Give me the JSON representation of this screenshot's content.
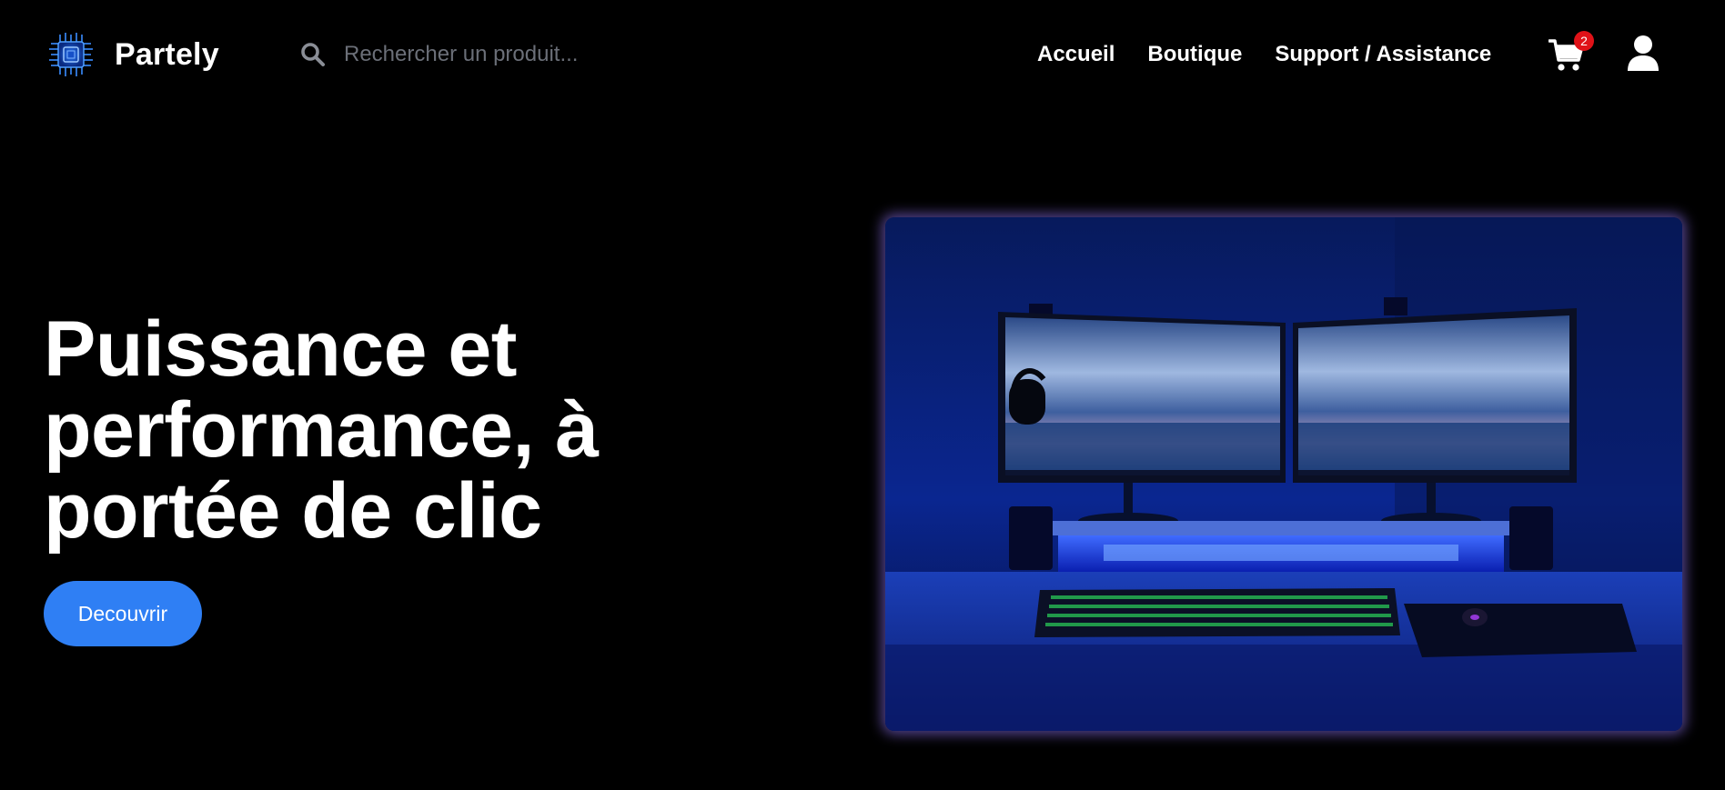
{
  "brand": {
    "name": "Partely",
    "accent_color": "#2f7ff4"
  },
  "search": {
    "placeholder": "Rechercher un produit...",
    "value": ""
  },
  "nav": {
    "items": [
      {
        "label": "Accueil"
      },
      {
        "label": "Boutique"
      },
      {
        "label": "Support / Assistance"
      }
    ]
  },
  "cart": {
    "count": "2",
    "badge_color": "#e01218",
    "icon": "shopping-cart-icon"
  },
  "user": {
    "icon": "user-icon"
  },
  "hero": {
    "title": "Puissance et performance, à portée de clic",
    "cta_label": "Decouvrir",
    "image_icon": "gaming-setup-photo"
  }
}
